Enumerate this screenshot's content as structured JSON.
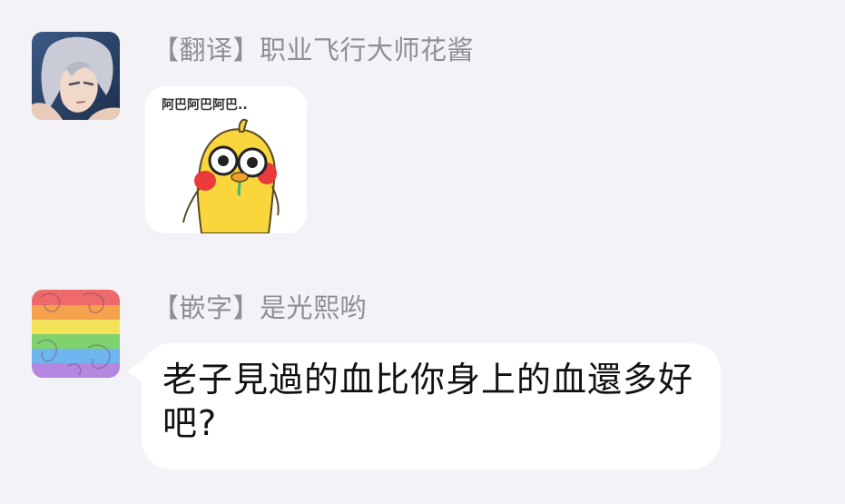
{
  "messages": [
    {
      "sender_label": "【翻译】职业飞行大师花酱",
      "avatar_icon": "anime-boy-avatar-icon",
      "sticker": {
        "caption": "阿巴阿巴阿巴..",
        "icon": "yellow-duck-sticker-icon"
      }
    },
    {
      "sender_label": "【嵌字】是光熙哟",
      "avatar_icon": "rainbow-avatar-icon",
      "text": "老子見過的血比你身上的血還多好吧?"
    }
  ],
  "colors": {
    "background": "#f2f2f7",
    "bubble": "#ffffff",
    "sender_text": "#8e8e93",
    "message_text": "#111111"
  }
}
